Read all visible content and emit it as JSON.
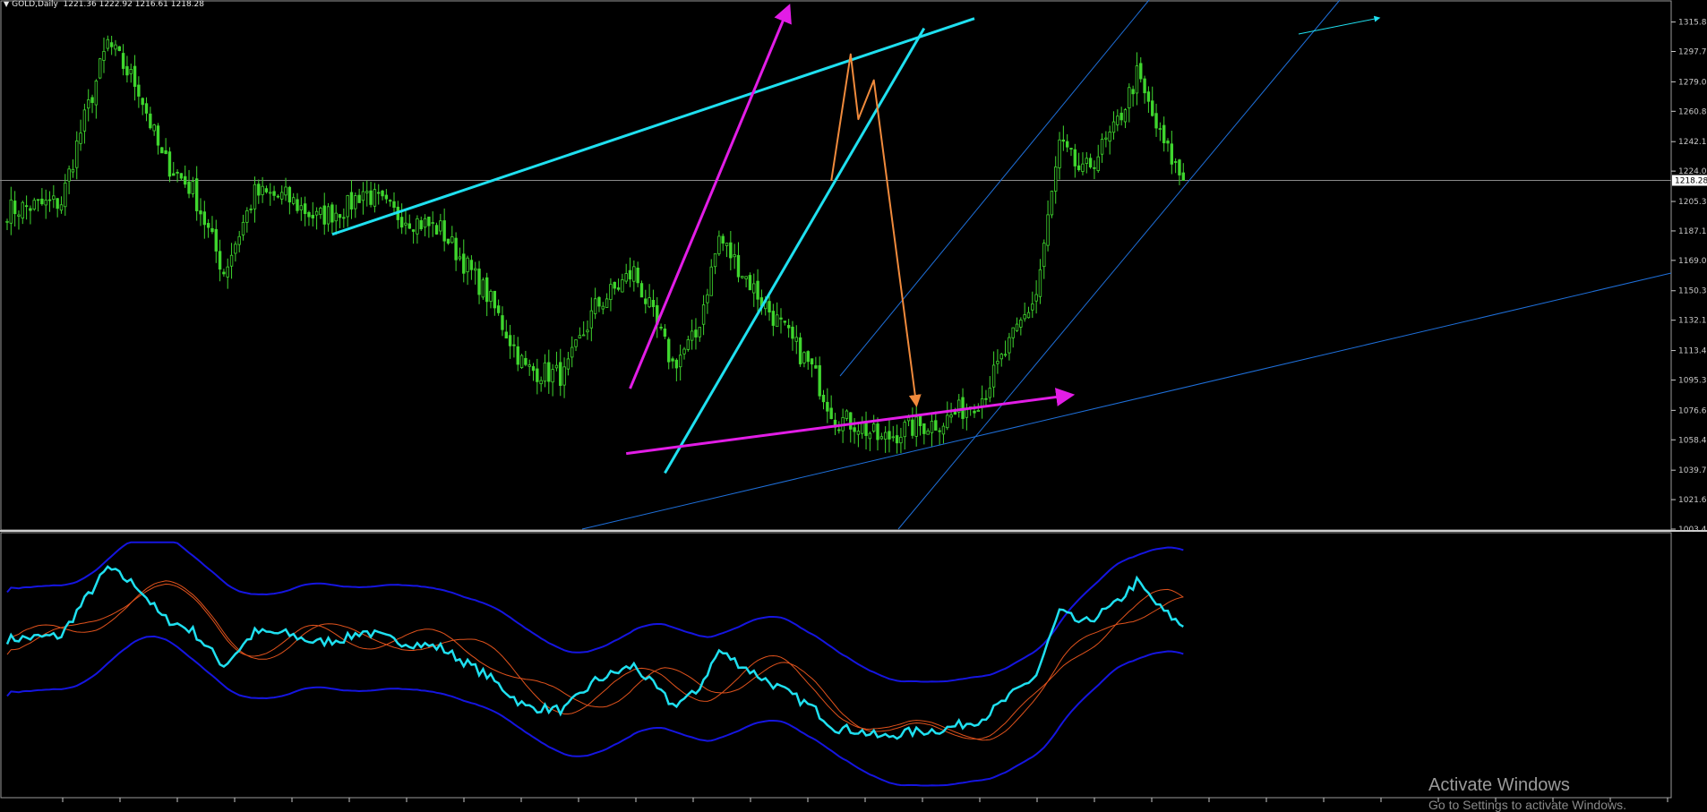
{
  "window": {
    "symbol_label": "GOLD,Daily",
    "ohlc_label": "1221.36 1222.92 1216.61 1218.28"
  },
  "watermark": {
    "title": "Activate Windows",
    "subtitle": "Go to Settings to activate Windows."
  },
  "colors": {
    "background": "#000000",
    "candle": "#3fd62e",
    "axis": "#c8c8c8",
    "grid_hline": "#8a8a8a",
    "trend_cyan": "#1fe0f0",
    "trend_thin_blue": "#1e6fd9",
    "trend_magenta": "#e21de6",
    "projection_orange": "#f08a3c",
    "osc_line": "#1fe0f0",
    "osc_band_blue": "#1515e0",
    "osc_band_orange": "#e0521c",
    "current_price_bg": "#ffffff"
  },
  "chart_data": [
    {
      "type": "candlestick",
      "symbol": "GOLD",
      "timeframe": "Daily",
      "ohlc_last": {
        "open": 1221.36,
        "high": 1222.92,
        "low": 1216.61,
        "close": 1218.28
      },
      "ylim": [
        1003.45,
        1325.0
      ],
      "y_ticks": [
        "1315.85",
        "1297.70",
        "1279.00",
        "1260.85",
        "1242.15",
        "1224.00",
        "1205.30",
        "1187.15",
        "1169.00",
        "1150.30",
        "1132.15",
        "1113.45",
        "1095.30",
        "1076.60",
        "1058.45",
        "1039.75",
        "1021.60",
        "1003.45"
      ],
      "current_price": "1218.28",
      "price_path_index": [
        0,
        14,
        18,
        26,
        34,
        40,
        48,
        56,
        64,
        72,
        80,
        88,
        92,
        100,
        112,
        124,
        134,
        144,
        152,
        162,
        172,
        178,
        184,
        194,
        208,
        214,
        220,
        226,
        232,
        242,
        252,
        258,
        266,
        272,
        278,
        286,
        292,
        298,
        304
      ],
      "price_path_close": [
        1200,
        1205,
        1240,
        1303,
        1275,
        1232,
        1212,
        1162,
        1210,
        1208,
        1195,
        1202,
        1212,
        1198,
        1188,
        1148,
        1102,
        1098,
        1140,
        1162,
        1105,
        1122,
        1183,
        1148,
        1102,
        1072,
        1068,
        1058,
        1065,
        1070,
        1085,
        1112,
        1148,
        1240,
        1222,
        1248,
        1283,
        1245,
        1218
      ],
      "overlays": [
        {
          "name": "cyan channel top",
          "color": "trend_cyan",
          "points": [
            [
              84,
              1185
            ],
            [
              250,
              1318
            ]
          ]
        },
        {
          "name": "cyan channel support",
          "color": "trend_cyan",
          "points": [
            [
              170,
              1038
            ],
            [
              237,
              1312
            ]
          ]
        },
        {
          "name": "magenta impulse",
          "color": "trend_magenta",
          "arrow": true,
          "points": [
            [
              161,
              1090
            ],
            [
              202,
              1325
            ]
          ]
        },
        {
          "name": "magenta base",
          "color": "trend_magenta",
          "arrow": true,
          "points": [
            [
              160,
              1050
            ],
            [
              275,
              1086
            ]
          ]
        },
        {
          "name": "orange projection",
          "color": "projection_orange",
          "arrow": true,
          "points": [
            [
              213,
              1218
            ],
            [
              218,
              1296
            ],
            [
              220,
              1256
            ],
            [
              224,
              1280
            ],
            [
              235,
              1080
            ]
          ]
        }
      ]
    },
    {
      "type": "line",
      "name": "oscillator with bands",
      "no_axis_labels": true
    }
  ]
}
